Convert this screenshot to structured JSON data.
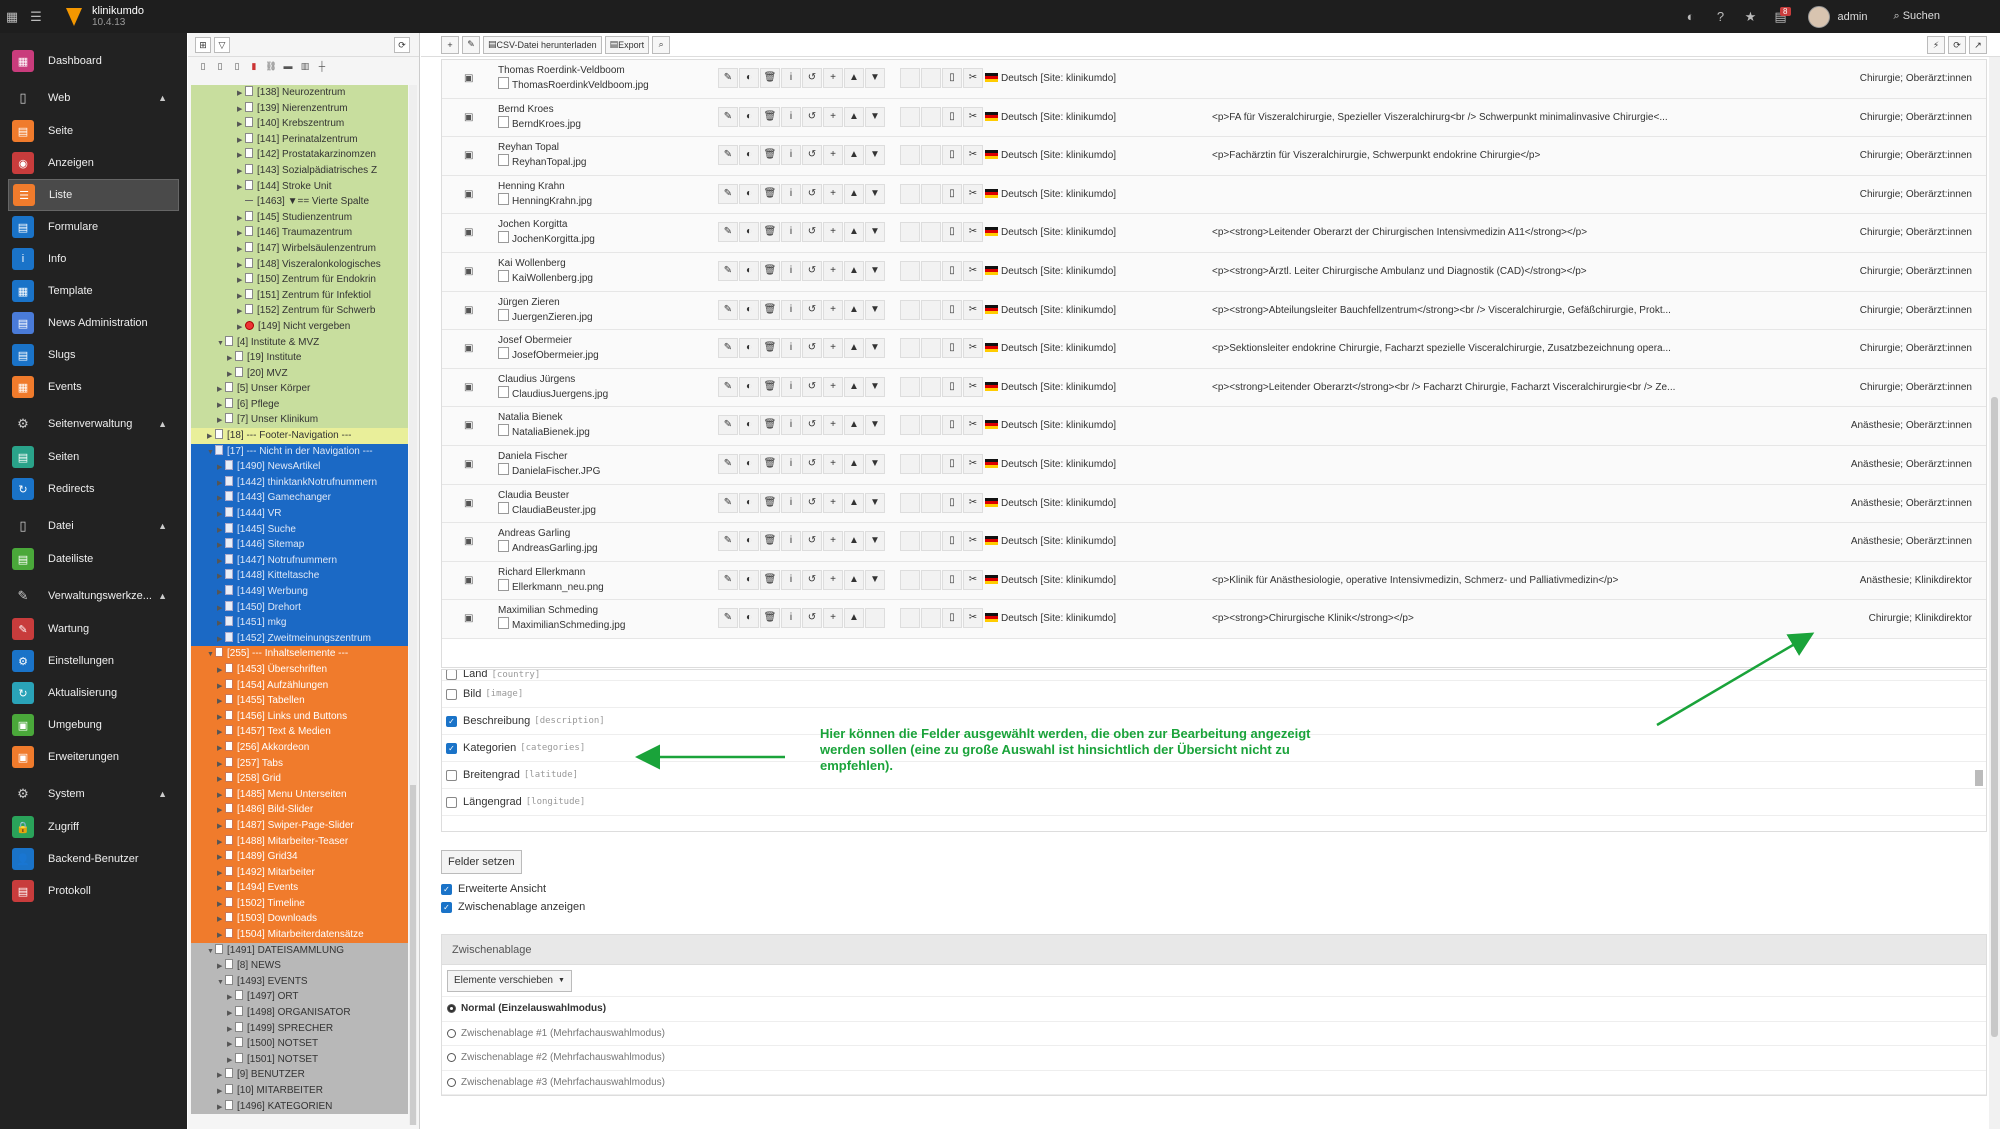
{
  "topbar": {
    "site_name": "klinikumdo",
    "version": "10.4.13",
    "user": "admin",
    "search": "Suchen",
    "badge": "8"
  },
  "modules": {
    "dashboard": "Dashboard",
    "groups": [
      {
        "label": "Web",
        "items": [
          "Seite",
          "Anzeigen",
          "Liste",
          "Formulare",
          "Info",
          "Template",
          "News Administration",
          "Slugs",
          "Events"
        ]
      },
      {
        "label": "Seitenverwaltung",
        "items": [
          "Seiten",
          "Redirects"
        ]
      },
      {
        "label": "Datei",
        "items": [
          "Dateiliste"
        ]
      },
      {
        "label": "Verwaltungswerkze...",
        "items": [
          "Wartung",
          "Einstellungen",
          "Aktualisierung",
          "Umgebung",
          "Erweiterungen"
        ]
      },
      {
        "label": "System",
        "items": [
          "Zugriff",
          "Backend-Benutzer",
          "Protokoll"
        ]
      }
    ],
    "active": "Liste"
  },
  "tree": [
    {
      "t": "[138] Neurozentrum",
      "c": "green",
      "d": 5
    },
    {
      "t": "[139] Nierenzentrum",
      "c": "green",
      "d": 5
    },
    {
      "t": "[140] Krebszentrum",
      "c": "green",
      "d": 5
    },
    {
      "t": "[141] Perinatalzentrum",
      "c": "green",
      "d": 5
    },
    {
      "t": "[142] Prostatakarzinomzen",
      "c": "green",
      "d": 5
    },
    {
      "t": "[143] Sozialpädiatrisches Z",
      "c": "green",
      "d": 5
    },
    {
      "t": "[144] Stroke Unit",
      "c": "green",
      "d": 5
    },
    {
      "t": "[1463] ▼== Vierte Spalte",
      "c": "green",
      "d": 5,
      "sep": true
    },
    {
      "t": "[145] Studienzentrum",
      "c": "green",
      "d": 5
    },
    {
      "t": "[146] Traumazentrum",
      "c": "green",
      "d": 5
    },
    {
      "t": "[147] Wirbelsäulenzentrum",
      "c": "green",
      "d": 5
    },
    {
      "t": "[148] Viszeralonkologisches",
      "c": "green",
      "d": 5
    },
    {
      "t": "[150] Zentrum für Endokrin",
      "c": "green",
      "d": 5
    },
    {
      "t": "[151] Zentrum für Infektiol",
      "c": "green",
      "d": 5
    },
    {
      "t": "[152] Zentrum für Schwerb",
      "c": "green",
      "d": 5
    },
    {
      "t": "[149] Nicht vergeben",
      "c": "green",
      "d": 5,
      "red": true
    },
    {
      "t": "[4] Institute & MVZ",
      "c": "green",
      "d": 3,
      "open": true
    },
    {
      "t": "[19] Institute",
      "c": "green",
      "d": 4
    },
    {
      "t": "[20] MVZ",
      "c": "green",
      "d": 4
    },
    {
      "t": "[5] Unser Körper",
      "c": "green",
      "d": 3
    },
    {
      "t": "[6] Pflege",
      "c": "green",
      "d": 3
    },
    {
      "t": "[7] Unser Klinikum",
      "c": "green",
      "d": 3
    },
    {
      "t": "[18] --- Footer-Navigation ---",
      "c": "yellow",
      "d": 2
    },
    {
      "t": "[17] --- Nicht in der Navigation ---",
      "c": "blue",
      "d": 2,
      "open": true
    },
    {
      "t": "[1490] NewsArtikel",
      "c": "blue",
      "d": 3
    },
    {
      "t": "[1442] thinktankNotrufnummern",
      "c": "blue",
      "d": 3
    },
    {
      "t": "[1443] Gamechanger",
      "c": "blue",
      "d": 3
    },
    {
      "t": "[1444] VR",
      "c": "blue",
      "d": 3
    },
    {
      "t": "[1445] Suche",
      "c": "blue",
      "d": 3
    },
    {
      "t": "[1446] Sitemap",
      "c": "blue",
      "d": 3
    },
    {
      "t": "[1447] Notrufnummern",
      "c": "blue",
      "d": 3
    },
    {
      "t": "[1448] Kitteltasche",
      "c": "blue",
      "d": 3
    },
    {
      "t": "[1449] Werbung",
      "c": "blue",
      "d": 3
    },
    {
      "t": "[1450] Drehort",
      "c": "blue",
      "d": 3
    },
    {
      "t": "[1451] mkg",
      "c": "blue",
      "d": 3
    },
    {
      "t": "[1452] Zweitmeinungszentrum",
      "c": "blue",
      "d": 3
    },
    {
      "t": "[255] --- Inhaltselemente ---",
      "c": "orange",
      "d": 2,
      "open": true
    },
    {
      "t": "[1453] Überschriften",
      "c": "orange",
      "d": 3
    },
    {
      "t": "[1454] Aufzählungen",
      "c": "orange",
      "d": 3
    },
    {
      "t": "[1455] Tabellen",
      "c": "orange",
      "d": 3
    },
    {
      "t": "[1456] Links und Buttons",
      "c": "orange",
      "d": 3
    },
    {
      "t": "[1457] Text & Medien",
      "c": "orange",
      "d": 3
    },
    {
      "t": "[256] Akkordeon",
      "c": "orange",
      "d": 3
    },
    {
      "t": "[257] Tabs",
      "c": "orange",
      "d": 3
    },
    {
      "t": "[258] Grid",
      "c": "orange",
      "d": 3
    },
    {
      "t": "[1485] Menu Unterseiten",
      "c": "orange",
      "d": 3
    },
    {
      "t": "[1486] Bild-Slider",
      "c": "orange",
      "d": 3
    },
    {
      "t": "[1487] Swiper-Page-Slider",
      "c": "orange",
      "d": 3
    },
    {
      "t": "[1488] Mitarbeiter-Teaser",
      "c": "orange",
      "d": 3
    },
    {
      "t": "[1489] Grid34",
      "c": "orange",
      "d": 3
    },
    {
      "t": "[1492] Mitarbeiter",
      "c": "orange",
      "d": 3
    },
    {
      "t": "[1494] Events",
      "c": "orange",
      "d": 3
    },
    {
      "t": "[1502] Timeline",
      "c": "orange",
      "d": 3
    },
    {
      "t": "[1503] Downloads",
      "c": "orange",
      "d": 3
    },
    {
      "t": "[1504] Mitarbeiterdatensätze",
      "c": "orange",
      "d": 3
    },
    {
      "t": "[1491] DATEISAMMLUNG",
      "c": "gray",
      "d": 2,
      "open": true
    },
    {
      "t": "[8] NEWS",
      "c": "gray",
      "d": 3
    },
    {
      "t": "[1493] EVENTS",
      "c": "gray",
      "d": 3,
      "open": true
    },
    {
      "t": "[1497] ORT",
      "c": "gray",
      "d": 4
    },
    {
      "t": "[1498] ORGANISATOR",
      "c": "gray",
      "d": 4
    },
    {
      "t": "[1499] SPRECHER",
      "c": "gray",
      "d": 4
    },
    {
      "t": "[1500] NOTSET",
      "c": "gray",
      "d": 4
    },
    {
      "t": "[1501] NOTSET",
      "c": "gray",
      "d": 4
    },
    {
      "t": "[9] BENUTZER",
      "c": "gray",
      "d": 3
    },
    {
      "t": "[10] MITARBEITER",
      "c": "gray",
      "d": 3
    },
    {
      "t": "[1496] KATEGORIEN",
      "c": "gray",
      "d": 3
    }
  ],
  "toolbar": {
    "csv": "CSV-Datei herunterladen",
    "export": "Export"
  },
  "lang": "Deutsch [Site: klinikumdo]",
  "records": [
    {
      "name": "Thomas Roerdink-Veldboom",
      "img": "ThomasRoerdinkVeldboom.jpg",
      "desc": "",
      "cat": "Chirurgie; Oberärzt:innen"
    },
    {
      "name": "Bernd Kroes",
      "img": "BerndKroes.jpg",
      "desc": "<p>FA für Viszeralchirurgie, Spezieller Viszeralchirurg<br /> Schwerpunkt minimalinvasive Chirurgie<...",
      "cat": "Chirurgie; Oberärzt:innen"
    },
    {
      "name": "Reyhan Topal",
      "img": "ReyhanTopal.jpg",
      "desc": "<p>Fachärztin für Viszeralchirurgie, Schwerpunkt endokrine Chirurgie</p>",
      "cat": "Chirurgie; Oberärzt:innen"
    },
    {
      "name": "Henning Krahn",
      "img": "HenningKrahn.jpg",
      "desc": "",
      "cat": "Chirurgie; Oberärzt:innen"
    },
    {
      "name": "Jochen Korgitta",
      "img": "JochenKorgitta.jpg",
      "desc": "<p><strong>Leitender Oberarzt der Chirurgischen Intensivmedizin A11</strong></p>",
      "cat": "Chirurgie; Oberärzt:innen"
    },
    {
      "name": "Kai Wollenberg",
      "img": "KaiWollenberg.jpg",
      "desc": "<p><strong>Ärztl. Leiter Chirurgische Ambulanz und Diagnostik (CAD)</strong></p>",
      "cat": "Chirurgie; Oberärzt:innen"
    },
    {
      "name": "Jürgen Zieren",
      "img": "JuergenZieren.jpg",
      "desc": "<p><strong>Abteilungsleiter Bauchfellzentrum</strong><br /> Visceralchirurgie, Gefäßchirurgie, Prokt...",
      "cat": "Chirurgie; Oberärzt:innen"
    },
    {
      "name": "Josef Obermeier",
      "img": "JosefObermeier.jpg",
      "desc": "<p>Sektionsleiter endokrine Chirurgie, Facharzt spezielle Visceralchirurgie, Zusatzbezeichnung opera...",
      "cat": "Chirurgie; Oberärzt:innen"
    },
    {
      "name": "Claudius Jürgens",
      "img": "ClaudiusJuergens.jpg",
      "desc": "<p><strong>Leitender Oberarzt</strong><br /> Facharzt Chirurgie, Facharzt Visceralchirurgie<br /> Ze...",
      "cat": "Chirurgie; Oberärzt:innen"
    },
    {
      "name": "Natalia Bienek",
      "img": "NataliaBienek.jpg",
      "desc": "",
      "cat": "Anästhesie; Oberärzt:innen"
    },
    {
      "name": "Daniela Fischer",
      "img": "DanielaFischer.JPG",
      "desc": "",
      "cat": "Anästhesie; Oberärzt:innen"
    },
    {
      "name": "Claudia Beuster",
      "img": "ClaudiaBeuster.jpg",
      "desc": "",
      "cat": "Anästhesie; Oberärzt:innen"
    },
    {
      "name": "Andreas Garling",
      "img": "AndreasGarling.jpg",
      "desc": "",
      "cat": "Anästhesie; Oberärzt:innen"
    },
    {
      "name": "Richard Ellerkmann",
      "img": "Ellerkmann_neu.png",
      "desc": "<p>Klinik für Anästhesiologie, operative Intensivmedizin, Schmerz- und Palliativmedizin</p>",
      "cat": "Anästhesie; Klinikdirektor"
    },
    {
      "name": "Maximilian Schmeding",
      "img": "MaximilianSchmeding.jpg",
      "desc": "<p><strong>Chirurgische Klinik</strong></p>",
      "cat": "Chirurgie; Klinikdirektor"
    }
  ],
  "fields": [
    {
      "label": "Land",
      "key": "[country]",
      "checked": false
    },
    {
      "label": "Bild",
      "key": "[image]",
      "checked": false
    },
    {
      "label": "Beschreibung",
      "key": "[description]",
      "checked": true
    },
    {
      "label": "Kategorien",
      "key": "[categories]",
      "checked": true
    },
    {
      "label": "Breitengrad",
      "key": "[latitude]",
      "checked": false
    },
    {
      "label": "Längengrad",
      "key": "[longitude]",
      "checked": false
    }
  ],
  "annotation": "Hier können die Felder ausgewählt werden, die oben zur Bearbeitung angezeigt werden sollen (eine zu große Auswahl ist hinsichtlich der Übersicht nicht zu empfehlen).",
  "set_fields": "Felder setzen",
  "opts": {
    "extended": "Erweiterte Ansicht",
    "clipboard": "Zwischenablage anzeigen"
  },
  "clipboard": {
    "title": "Zwischenablage",
    "select": "Elemente verschieben",
    "rows": [
      "Normal (Einzelauswahlmodus)",
      "Zwischenablage #1 (Mehrfachauswahlmodus)",
      "Zwischenablage #2 (Mehrfachauswahlmodus)",
      "Zwischenablage #3 (Mehrfachauswahlmodus)"
    ]
  },
  "colors": {
    "accent": "#1a73c8",
    "annotation": "#1aa33a"
  }
}
